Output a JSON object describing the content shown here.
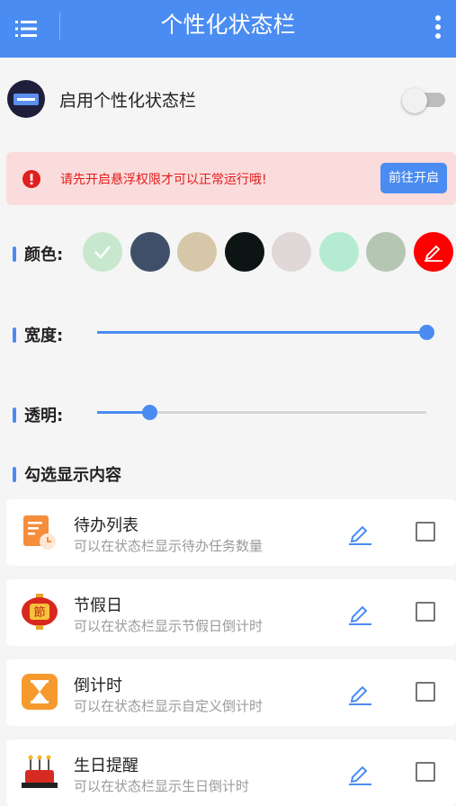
{
  "appbar": {
    "title": "个性化状态栏"
  },
  "enable": {
    "label": "启用个性化状态栏",
    "enabled": false
  },
  "warning": {
    "text": "请先开启悬浮权限才可以正常运行哦!",
    "button": "前往开启"
  },
  "color": {
    "label": "颜色:",
    "swatches": [
      "#c7e8cf",
      "#3f4f69",
      "#d6c7a8",
      "#0c1514",
      "#e0d8d8",
      "#b5ecd1",
      "#b5c6b3",
      "#ff0000"
    ],
    "selected_index": 0
  },
  "width": {
    "label": "宽度:",
    "value_fraction": 1.0
  },
  "opacity": {
    "label": "透明:",
    "value_fraction": 0.16
  },
  "content_section": {
    "label": "勾选显示内容"
  },
  "items": [
    {
      "title": "待办列表",
      "subtitle": "可以在状态栏显示待办任务数量",
      "icon": "todo-list-icon",
      "checked": false
    },
    {
      "title": "节假日",
      "subtitle": "可以在状态栏显示节假日倒计时",
      "icon": "holiday-lantern-icon",
      "icon_text": "節",
      "checked": false
    },
    {
      "title": "倒计时",
      "subtitle": "可以在状态栏显示自定义倒计时",
      "icon": "hourglass-icon",
      "checked": false
    },
    {
      "title": "生日提醒",
      "subtitle": "可以在状态栏显示生日倒计时",
      "icon": "birthday-cake-icon",
      "checked": false
    }
  ],
  "colors": {
    "accent": "#4a8cf1",
    "warning_bg": "#fbdcdc",
    "warning_text": "#e11d1d"
  }
}
